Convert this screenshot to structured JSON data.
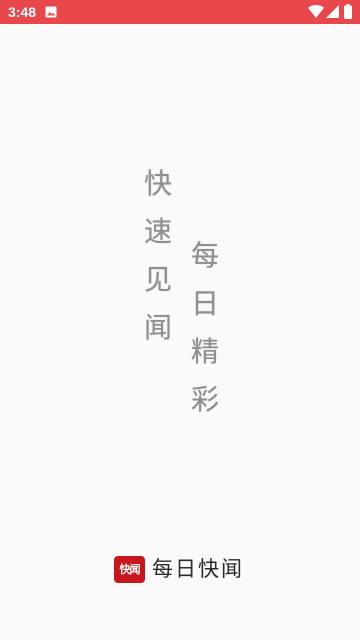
{
  "status_bar": {
    "time": "3:48",
    "background_color": "#e8474c",
    "icons": [
      "image-icon",
      "wifi-icon",
      "cellular-signal-icon",
      "battery-icon"
    ]
  },
  "slogan": {
    "column_1": [
      "快",
      "速",
      "见",
      "闻"
    ],
    "column_2": [
      "每",
      "日",
      "精",
      "彩"
    ]
  },
  "brand": {
    "logo_text": "快闻",
    "logo_color": "#c8161d",
    "name": "每日快闻"
  }
}
